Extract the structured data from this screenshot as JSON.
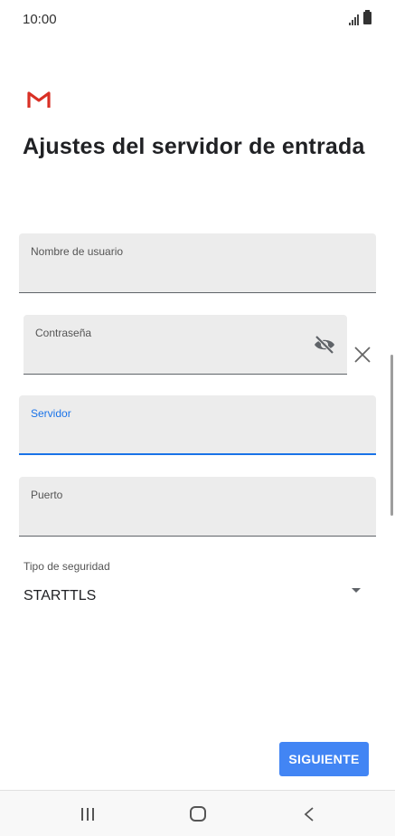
{
  "status_bar": {
    "time": "10:00"
  },
  "page": {
    "title": "Ajustes del servidor de entrada"
  },
  "form": {
    "username_label": "Nombre de usuario",
    "password_label": "Contraseña",
    "server_label": "Servidor",
    "port_label": "Puerto",
    "security_label": "Tipo de seguridad",
    "security_value": "STARTTLS"
  },
  "actions": {
    "next_label": "SIGUIENTE"
  },
  "colors": {
    "accent": "#1a73e8",
    "button": "#4285f4",
    "gmail_red": "#d93025"
  },
  "icons": [
    "gmail-logo",
    "signal-icon",
    "battery-icon",
    "eye-off-icon",
    "clear-icon",
    "dropdown-icon",
    "recents-icon",
    "home-icon",
    "back-icon"
  ]
}
